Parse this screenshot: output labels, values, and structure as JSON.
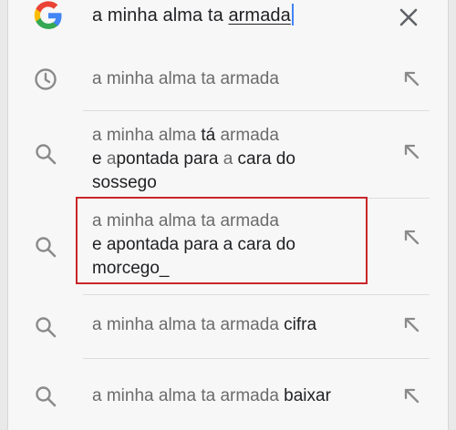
{
  "search": {
    "query_prefix": "a minha alma ta ",
    "query_typed": "armada",
    "clear_icon": "close-icon",
    "logo_icon": "google-g-logo"
  },
  "suggestions": [
    {
      "icon": "history-icon",
      "arrow": "fill-arrow-icon",
      "plain": "a minha alma ta armada"
    },
    {
      "icon": "search-icon",
      "arrow": "fill-arrow-icon",
      "line1_a": "a minha alma ",
      "line1_b": "tá",
      "line1_c": " armada",
      "line2_a": "e ",
      "line2_b": "a",
      "line2_c": "pontada para ",
      "line2_d": "a",
      "line2_e": " cara do",
      "line3": "sossego"
    },
    {
      "icon": "search-icon",
      "arrow": "fill-arrow-icon",
      "line1": "a minha alma ta armada",
      "line2": "e apontada para a cara do",
      "line3": "morcego_"
    },
    {
      "icon": "search-icon",
      "arrow": "fill-arrow-icon",
      "prefix": "a minha alma ta armada ",
      "suffix": "cifra"
    },
    {
      "icon": "search-icon",
      "arrow": "fill-arrow-icon",
      "prefix": "a minha alma ta armada ",
      "suffix": "baixar"
    }
  ],
  "colors": {
    "google_blue": "#4285f4",
    "google_red": "#ea4335",
    "google_yellow": "#fbbc05",
    "google_green": "#34a853",
    "highlight": "#c8262a",
    "text_dark": "#202124",
    "text_gray": "#6b6b6b"
  }
}
